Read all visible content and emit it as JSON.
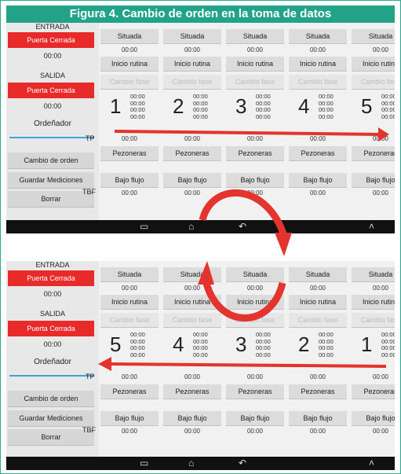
{
  "caption": "Figura 4. Cambio de orden en la toma de datos",
  "colors": {
    "accent": "#22a388",
    "alert_red": "#e82a2a",
    "arrow_red": "#e3342f"
  },
  "sidebar": {
    "entrada": "ENTRADA",
    "puerta_cerrada": "Puerta Cerrada",
    "time": "00:00",
    "salida": "SALIDA",
    "ordenador": "Ordeñador",
    "cambio_orden": "Cambio de orden",
    "guardar": "Guardar Mediciones",
    "borrar": "Borrar"
  },
  "labels": {
    "tp": "TP",
    "tbf": "TBF"
  },
  "buttons": {
    "situada": "Situada",
    "inicio": "Inicio rutina",
    "cambio_fase": "Cambio fase",
    "pezoneras": "Pezoneras",
    "bajo_flujo": "Bajo flujo"
  },
  "time": "00:00",
  "top_numbers": [
    "1",
    "2",
    "3",
    "4",
    "5"
  ],
  "bottom_numbers": [
    "5",
    "4",
    "3",
    "2",
    "1"
  ],
  "nav_icons": [
    "recent-apps-icon",
    "home-icon",
    "back-icon",
    "chevron-up-icon"
  ]
}
